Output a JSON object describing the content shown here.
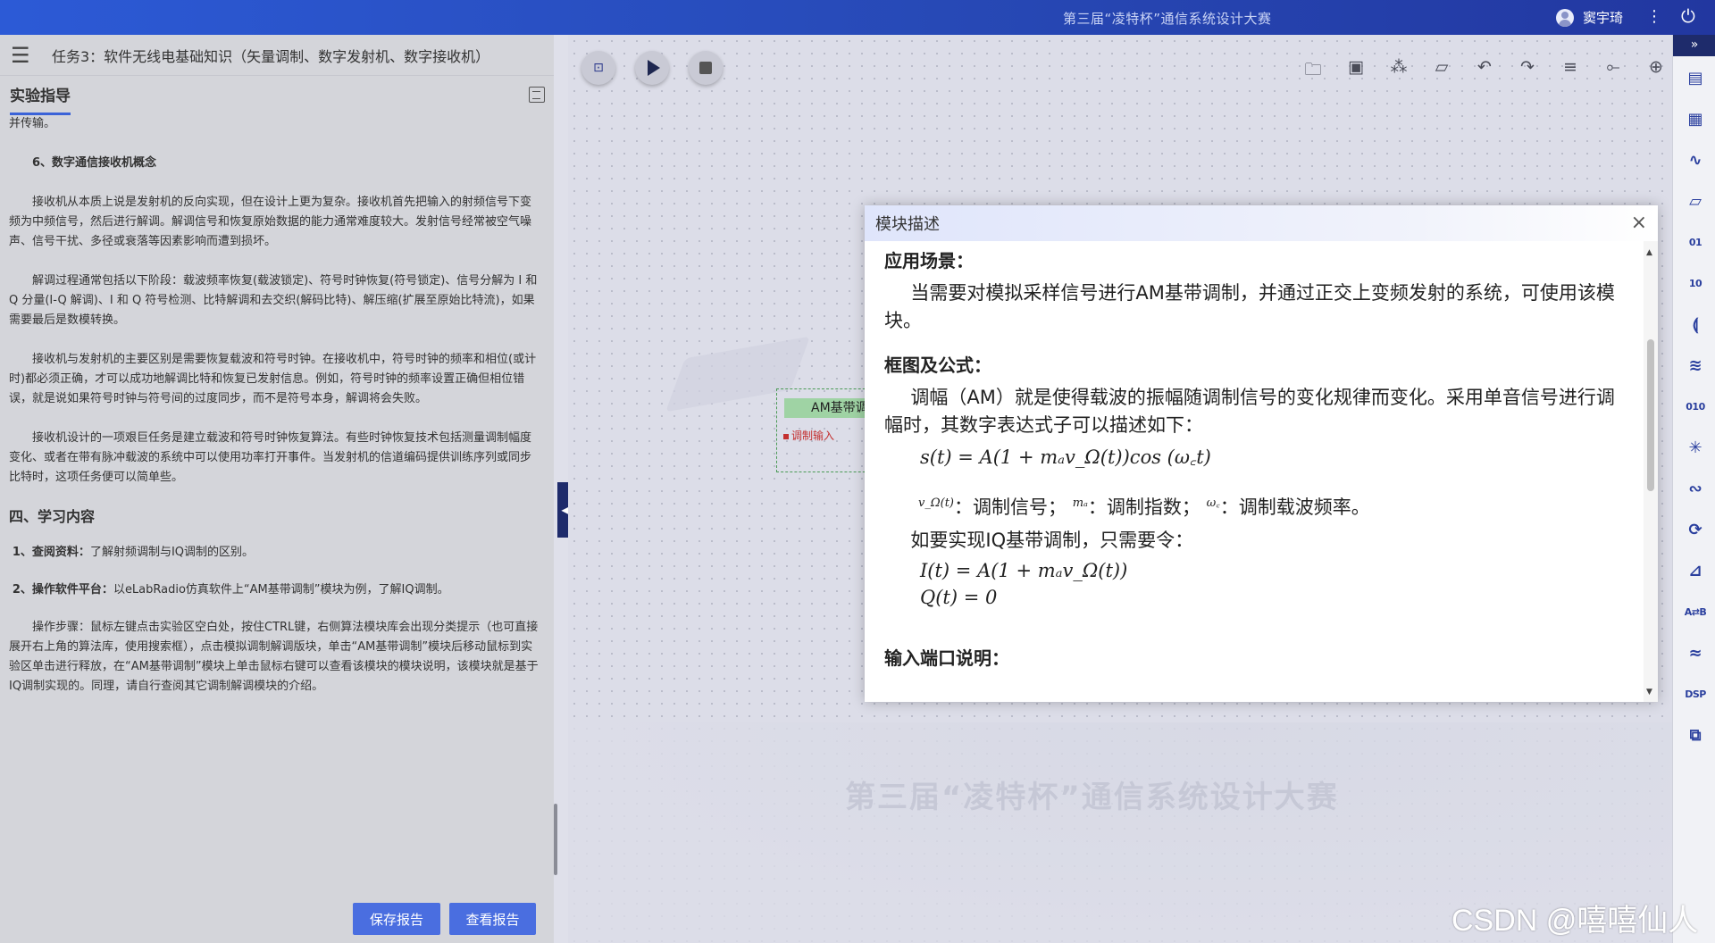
{
  "topbar": {
    "title": "第三届“凌特杯”通信系统设计大赛",
    "user_name": "窦宇琦",
    "more_icon": "more-vertical-icon",
    "power_icon": "power-icon"
  },
  "left_panel": {
    "task_title": "任务3：软件无线电基础知识（矢量调制、数字发射机、数字接收机）",
    "tab_label": "实验指导",
    "content": {
      "p0": "并传输。",
      "sub6": "6、数字通信接收机概念",
      "p1": "接收机从本质上说是发射机的反向实现，但在设计上更为复杂。接收机首先把输入的射频信号下变频为中频信号，然后进行解调。解调信号和恢复原始数据的能力通常难度较大。发射信号经常被空气噪声、信号干扰、多径或衰落等因素影响而遭到损坏。",
      "p2": "解调过程通常包括以下阶段：载波频率恢复(载波锁定)、符号时钟恢复(符号锁定)、信号分解为 I 和 Q 分量(I-Q 解调)、I 和 Q 符号检测、比特解调和去交织(解码比特)、解压缩(扩展至原始比特流)，如果需要最后是数模转换。",
      "p3": "接收机与发射机的主要区别是需要恢复载波和符号时钟。在接收机中，符号时钟的频率和相位(或计时)都必须正确，才可以成功地解调比特和恢复已发射信息。例如，符号时钟的频率设置正确但相位错误，就是说如果符号时钟与符号间的过度同步，而不是符号本身，解调将会失败。",
      "p4": "接收机设计的一项艰巨任务是建立载波和符号时钟恢复算法。有些时钟恢复技术包括测量调制幅度变化、或者在带有脉冲载波的系统中可以使用功率打开事件。当发射机的信道编码提供训练序列或同步比特时，这项任务便可以简单些。",
      "section4": "四、学习内容",
      "item1_label": "1、查阅资料：",
      "item1_text": "了解射频调制与IQ调制的区别。",
      "item2_label": "2、操作软件平台：",
      "item2_text": "以eLabRadio仿真软件上“AM基带调制”模块为例，了解IQ调制。",
      "p5": "操作步骤：鼠标左键点击实验区空白处，按住CTRL键，右侧算法模块库会出现分类提示（也可直接展开右上角的算法库，使用搜索框），点击模拟调制解调版块，单击“AM基带调制”模块后移动鼠标到实验区单击进行释放，在“AM基带调制”模块上单击鼠标右键可以查看该模块的模块说明，该模块就是基于IQ调制实现的。同理，请自行查阅其它调制解调模块的介绍。"
    },
    "save_report": "保存报告",
    "view_report": "查看报告"
  },
  "canvas": {
    "block_title": "AM基带调制",
    "block_port": "调制输入",
    "watermark": "第三届“凌特杯”通信系统设计大赛"
  },
  "modal": {
    "title": "模块描述",
    "h_app": "应用场景：",
    "app_text": "当需要对模拟采样信号进行AM基带调制，并通过正交上变频发射的系统，可使用该模块。",
    "h_diagram": "框图及公式：",
    "am_text": "调幅（AM）就是使得载波的振幅随调制信号的变化规律而变化。采用单音信号进行调幅时，其数字表达式子可以描述如下：",
    "formula_s": "s(t) = A(1 + mₐv_Ω(t))cos (ω꜀t)",
    "var1_sym": "v_Ω(t)",
    "var1_text": "：调制信号；",
    "var2_sym": "mₐ",
    "var2_text": "：调制指数；",
    "var3_sym": "ω꜀",
    "var3_text": "：调制载波频率。",
    "iq_text": "如要实现IQ基带调制，只需要令：",
    "formula_i": "I(t) = A(1 + mₐv_Ω(t))",
    "formula_q": "Q(t) = 0",
    "h_input": "输入端口说明："
  },
  "footer_watermark": "CSDN @嘻嘻仙人",
  "colors": {
    "topbar": "#2749b6",
    "accent_blue": "#4a6ee0",
    "sidebar_dark": "#1e2b6b",
    "block_green": "#9fd3a4"
  }
}
